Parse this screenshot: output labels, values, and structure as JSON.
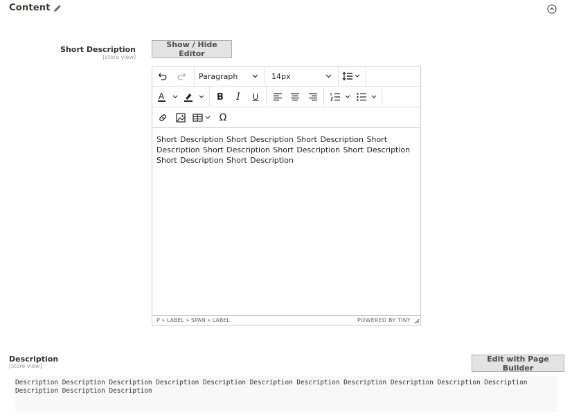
{
  "section": {
    "title": "Content",
    "icons": [
      "pencil-icon",
      "collapse-icon"
    ]
  },
  "short_description": {
    "label": "Short Description",
    "scope": "[store view]",
    "toggle_button": "Show / Hide Editor",
    "editor": {
      "block_format": "Paragraph",
      "font_size": "14px",
      "content": " Short Description  Short Description  Short Description  Short Description  Short Description  Short Description  Short Description  Short Description  Short Description",
      "path": "P » LABEL » SPAN » LABEL",
      "powered_by": "POWERED BY TINY"
    }
  },
  "description": {
    "label": "Description",
    "scope": "[store view]",
    "page_builder_button": "Edit with Page Builder",
    "content": " Description Description Description Description Description Description Description Description Description Description Description Description Description Description"
  }
}
